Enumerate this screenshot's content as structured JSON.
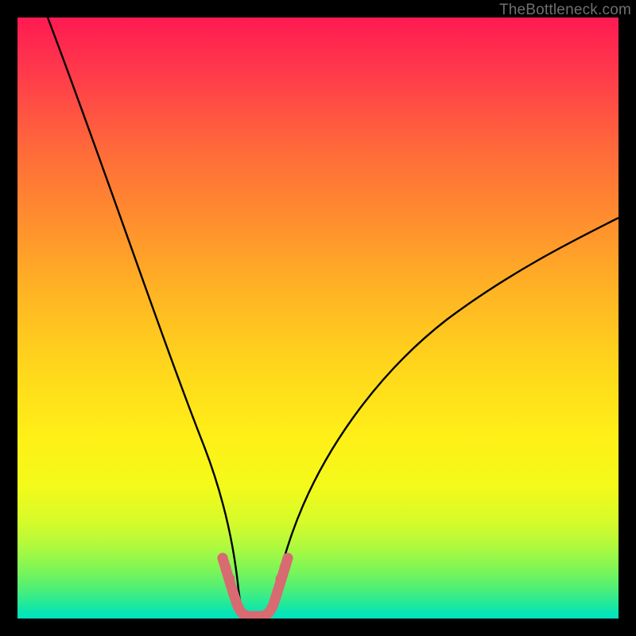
{
  "watermark": "TheBottleneck.com",
  "chart_data": {
    "type": "line",
    "title": "",
    "xlabel": "",
    "ylabel": "",
    "xlim": [
      0,
      100
    ],
    "ylim": [
      0,
      100
    ],
    "series": [
      {
        "name": "left-branch",
        "x": [
          5,
          10,
          15,
          20,
          25,
          28,
          30,
          32,
          33.5,
          34.5,
          35.5,
          36,
          36.5
        ],
        "y": [
          100,
          84,
          68,
          53,
          37,
          28,
          21,
          14,
          9,
          6,
          3.5,
          2,
          1.2
        ]
      },
      {
        "name": "right-branch",
        "x": [
          41,
          42,
          43.5,
          45,
          48,
          52,
          58,
          66,
          76,
          88,
          100
        ],
        "y": [
          1.2,
          2.5,
          5,
          8,
          13,
          19,
          26,
          34,
          42,
          50,
          57
        ]
      },
      {
        "name": "valley-marker",
        "x": [
          33,
          33.8,
          34.6,
          35.4,
          36.2,
          37,
          37.8,
          38.6,
          39.4,
          40.2,
          41,
          41.8,
          42.6,
          43.4,
          44.2
        ],
        "y": [
          9,
          6.5,
          4.5,
          3,
          2,
          1.4,
          1.2,
          1.2,
          1.4,
          2,
          3,
          4.5,
          6.5,
          9,
          11
        ]
      }
    ],
    "colors": {
      "curve": "#000000",
      "marker": "#d86a72"
    }
  }
}
